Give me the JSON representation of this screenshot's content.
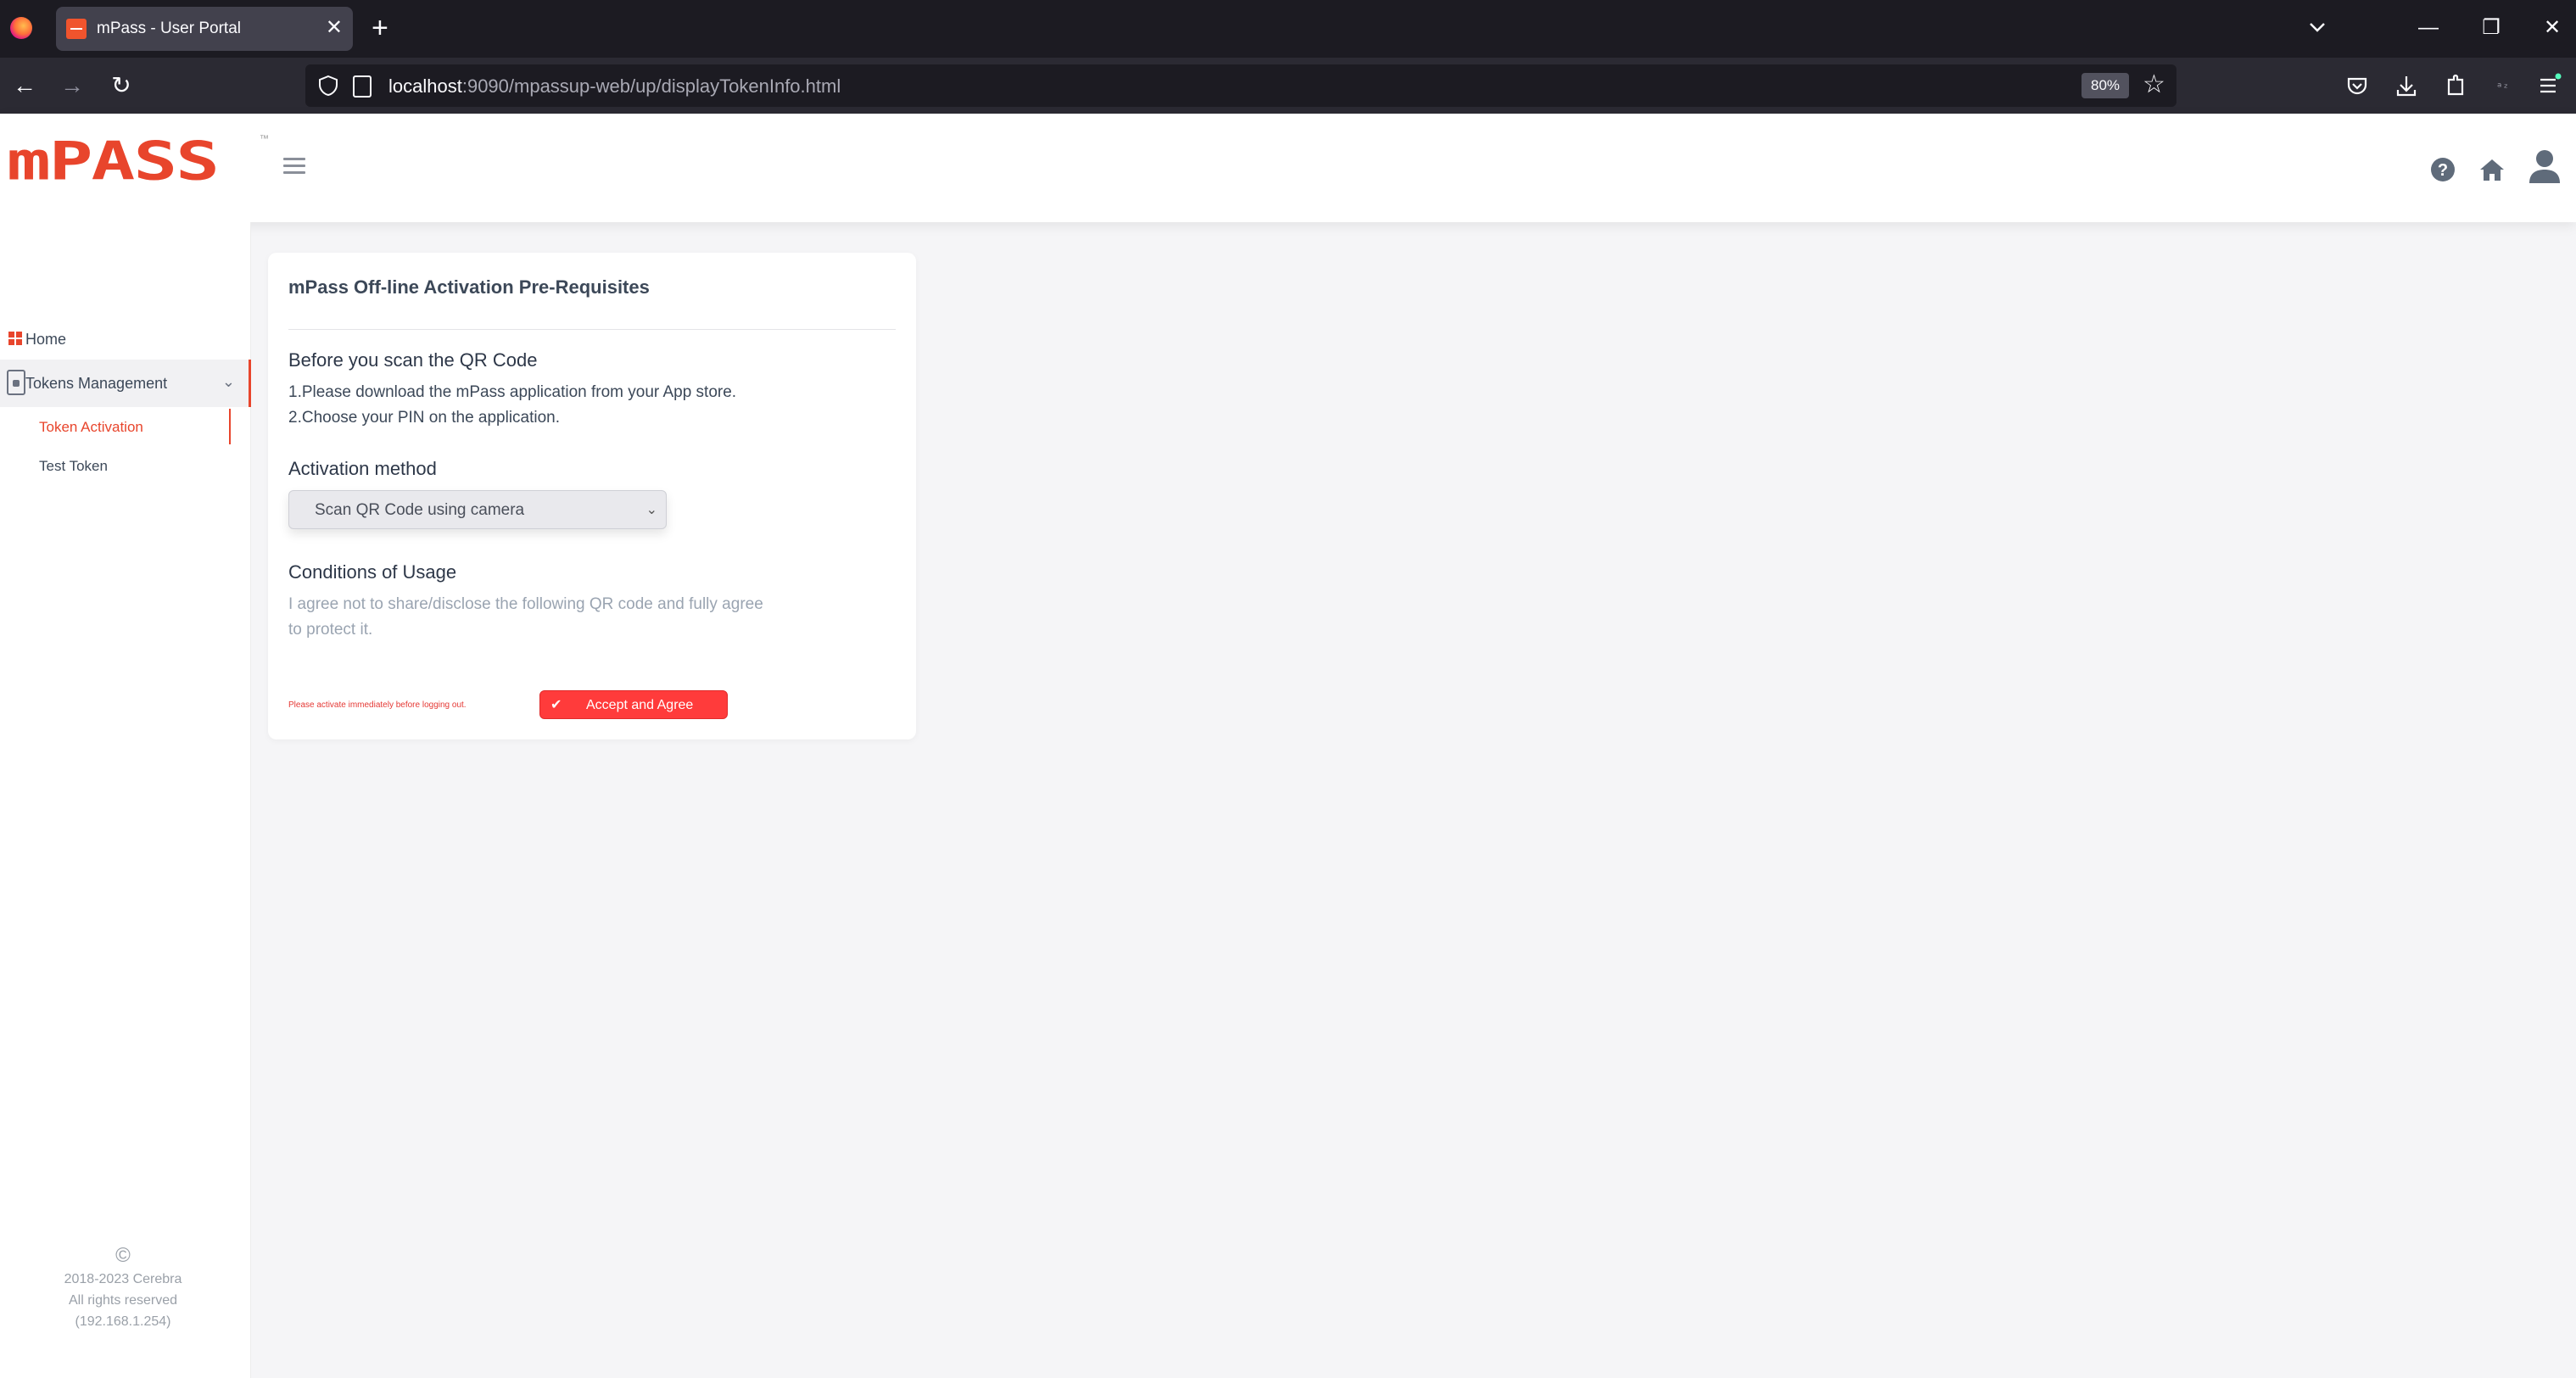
{
  "browser": {
    "tab_title": "mPass - User Portal",
    "tab_close": "✕",
    "new_tab": "+",
    "url_host": "localhost",
    "url_rest": ":9090/mpassup-web/up/displayTokenInfo.html",
    "zoom": "80%",
    "star": "☆",
    "win_minimize": "—",
    "win_restore": "❐",
    "win_close": "✕",
    "back": "←",
    "forward": "→",
    "reload": "↻"
  },
  "app": {
    "logo_text": "mPASS",
    "logo_tm": "™",
    "brand_color": "#e8452c"
  },
  "sidebar": {
    "home": "Home",
    "tokens_management": "Tokens Management",
    "chevron": "⌄",
    "token_activation": "Token Activation",
    "test_token": "Test Token",
    "footer_copy": "©",
    "footer_years": "2018-2023 Cerebra",
    "footer_rights": "All rights reserved",
    "footer_ip": "(192.168.1.254)"
  },
  "card": {
    "title": "mPass Off-line Activation Pre-Requisites",
    "before_title": "Before you scan the QR Code",
    "step1": "1.Please download the mPass application from your App store.",
    "step2": "2.Choose your PIN on the application.",
    "activation_title": "Activation method",
    "activation_value": "Scan QR Code using camera",
    "select_arrow": "⌄",
    "conditions_title": "Conditions of Usage",
    "conditions_text": "I agree not to share/disclose the following QR code and fully agree to protect it.",
    "warning": "Please activate immediately before logging out.",
    "accept_check": "✔",
    "accept_label": "Accept and Agree"
  }
}
